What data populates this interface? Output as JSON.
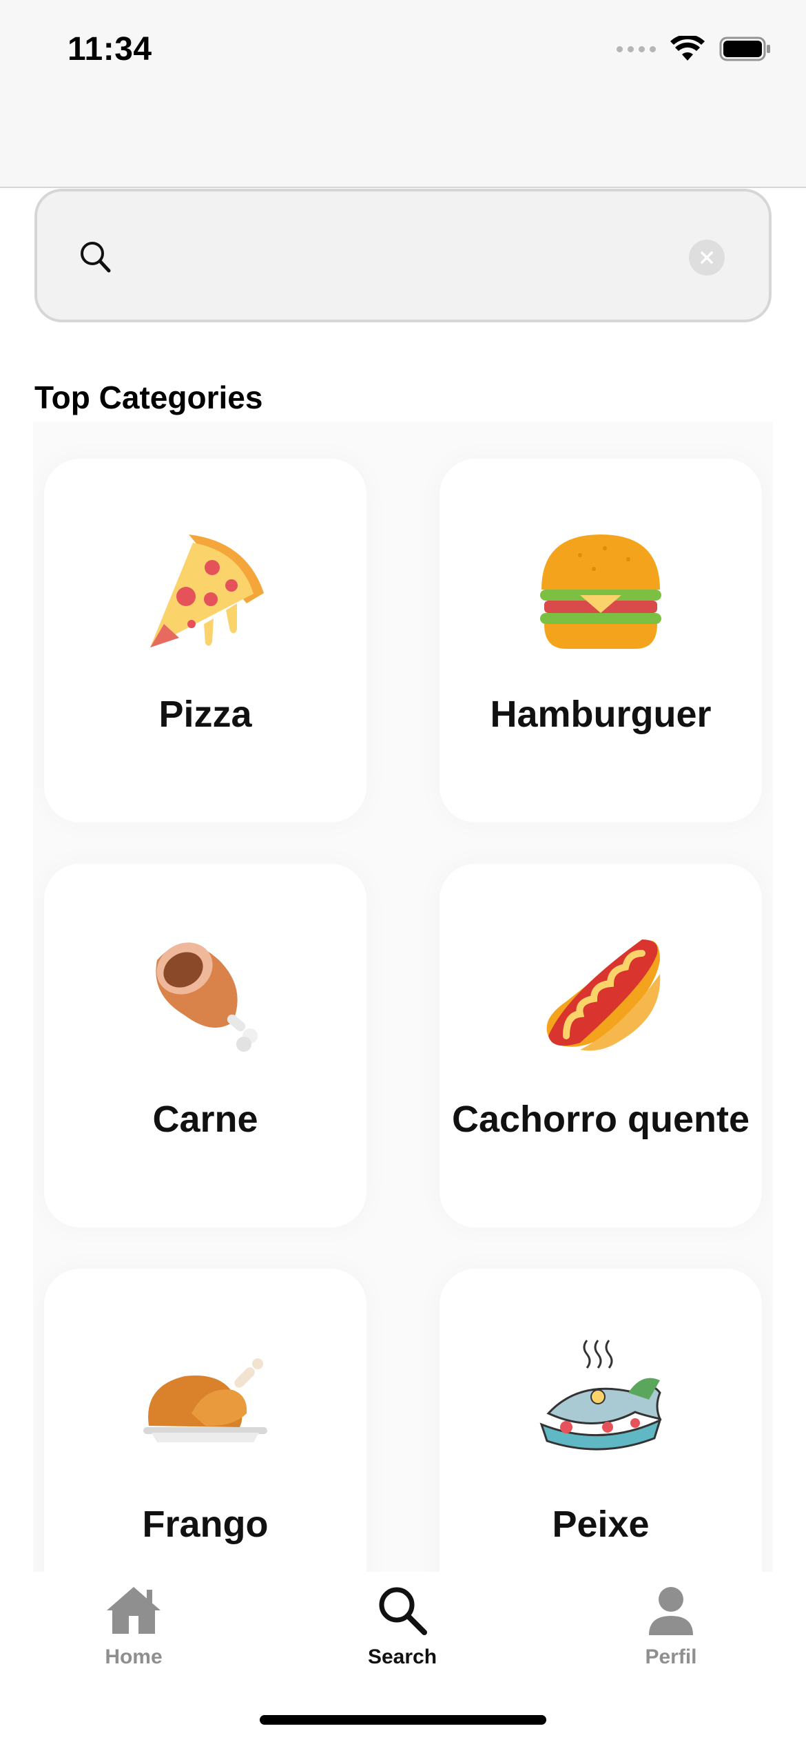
{
  "status_bar": {
    "time": "11:34"
  },
  "search": {
    "value": "",
    "placeholder": ""
  },
  "section_title": "Top Categories",
  "categories": [
    {
      "label": "Pizza",
      "icon": "pizza-icon"
    },
    {
      "label": "Hamburguer",
      "icon": "hamburger-icon"
    },
    {
      "label": "Carne",
      "icon": "meat-icon"
    },
    {
      "label": "Cachorro quente",
      "icon": "hotdog-icon"
    },
    {
      "label": "Frango",
      "icon": "chicken-icon"
    },
    {
      "label": "Peixe",
      "icon": "fish-icon"
    }
  ],
  "tabbar": {
    "home_label": "Home",
    "search_label": "Search",
    "perfil_label": "Perfil",
    "active_tab": "Search"
  },
  "colors": {
    "active": "#111111",
    "inactive": "#8f8f8f",
    "background": "#ffffff"
  }
}
